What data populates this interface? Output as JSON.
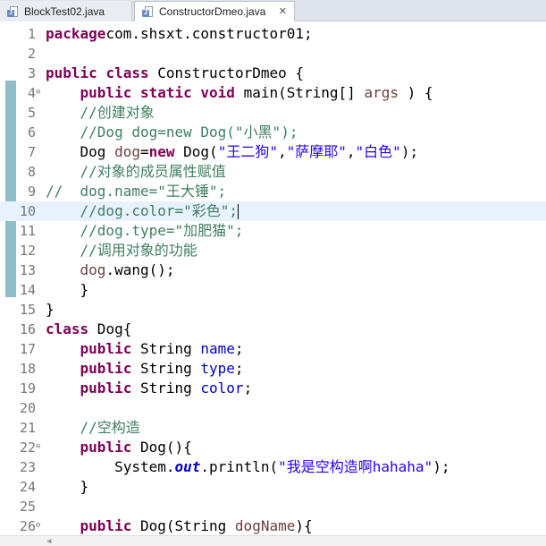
{
  "tabs": [
    {
      "label": "BlockTest02.java",
      "active": false
    },
    {
      "label": "ConstructorDmeo.java",
      "active": true,
      "close": "✕"
    }
  ],
  "colors": {
    "keyword": "#7f0055",
    "comment": "#3f7f5f",
    "string": "#2a00ff",
    "field": "#0000c0",
    "current_line": "#e8f2fe"
  },
  "editor": {
    "current_line": 10,
    "lines": [
      {
        "n": "1",
        "t": [
          [
            "kw",
            "package"
          ],
          [
            "",
            "com.shsxt.constructor01;"
          ]
        ]
      },
      {
        "n": "2",
        "t": []
      },
      {
        "n": "3",
        "t": [
          [
            "kw",
            "public"
          ],
          [
            "",
            " "
          ],
          [
            "kw",
            "class"
          ],
          [
            "",
            " ConstructorDmeo {"
          ]
        ]
      },
      {
        "n": "4",
        "fold": true,
        "t": [
          [
            "",
            "    "
          ],
          [
            "kw",
            "public"
          ],
          [
            "",
            " "
          ],
          [
            "kw",
            "static"
          ],
          [
            "",
            " "
          ],
          [
            "kw",
            "void"
          ],
          [
            "",
            " main(String[] "
          ],
          [
            "pm",
            "args"
          ],
          [
            "",
            " ) {"
          ]
        ]
      },
      {
        "n": "5",
        "t": [
          [
            "",
            "    "
          ],
          [
            "cm",
            "//创建对象"
          ]
        ]
      },
      {
        "n": "6",
        "t": [
          [
            "",
            "    "
          ],
          [
            "cm",
            "//Dog dog=new Dog(\"小黑\");"
          ]
        ]
      },
      {
        "n": "7",
        "t": [
          [
            "",
            "    Dog "
          ],
          [
            "vr",
            "dog"
          ],
          [
            "",
            "="
          ],
          [
            "kw",
            "new"
          ],
          [
            "",
            " Dog("
          ],
          [
            "st",
            "\"王二狗\""
          ],
          [
            "",
            ","
          ],
          [
            "st",
            "\"萨摩耶\""
          ],
          [
            "",
            ","
          ],
          [
            "st",
            "\"白色\""
          ],
          [
            "",
            ");"
          ]
        ]
      },
      {
        "n": "8",
        "t": [
          [
            "",
            "    "
          ],
          [
            "cm",
            "//对象的成员属性赋值"
          ]
        ]
      },
      {
        "n": "9",
        "t": [
          [
            "cm",
            "//  dog.name=\"王大锤\";"
          ]
        ]
      },
      {
        "n": "10",
        "t": [
          [
            "",
            "    "
          ],
          [
            "cm",
            "//dog.color=\"彩色\";"
          ]
        ],
        "cursor": true
      },
      {
        "n": "11",
        "t": [
          [
            "",
            "    "
          ],
          [
            "cm",
            "//dog.type=\"加肥猫\";"
          ]
        ]
      },
      {
        "n": "12",
        "t": [
          [
            "",
            "    "
          ],
          [
            "cm",
            "//调用对象的功能"
          ]
        ]
      },
      {
        "n": "13",
        "t": [
          [
            "",
            "    "
          ],
          [
            "vr",
            "dog"
          ],
          [
            "",
            ".wang();"
          ]
        ]
      },
      {
        "n": "14",
        "t": [
          [
            "",
            "    }"
          ]
        ]
      },
      {
        "n": "15",
        "t": [
          [
            "",
            "}"
          ]
        ]
      },
      {
        "n": "16",
        "t": [
          [
            "kw",
            "class"
          ],
          [
            "",
            " Dog{"
          ]
        ]
      },
      {
        "n": "17",
        "t": [
          [
            "",
            "    "
          ],
          [
            "kw",
            "public"
          ],
          [
            "",
            " String "
          ],
          [
            "fd",
            "name"
          ],
          [
            "",
            ";"
          ]
        ]
      },
      {
        "n": "18",
        "t": [
          [
            "",
            "    "
          ],
          [
            "kw",
            "public"
          ],
          [
            "",
            " String "
          ],
          [
            "fd",
            "type"
          ],
          [
            "",
            ";"
          ]
        ]
      },
      {
        "n": "19",
        "t": [
          [
            "",
            "    "
          ],
          [
            "kw",
            "public"
          ],
          [
            "",
            " String "
          ],
          [
            "fd",
            "color"
          ],
          [
            "",
            ";"
          ]
        ]
      },
      {
        "n": "20",
        "t": []
      },
      {
        "n": "21",
        "t": [
          [
            "",
            "    "
          ],
          [
            "cm",
            "//空构造"
          ]
        ]
      },
      {
        "n": "22",
        "fold": true,
        "t": [
          [
            "",
            "    "
          ],
          [
            "kw",
            "public"
          ],
          [
            "",
            " Dog(){"
          ]
        ]
      },
      {
        "n": "23",
        "t": [
          [
            "",
            "        System."
          ],
          [
            "sf",
            "out"
          ],
          [
            "",
            ".println("
          ],
          [
            "st",
            "\"我是空构造啊hahaha\""
          ],
          [
            "",
            ");"
          ]
        ]
      },
      {
        "n": "24",
        "t": [
          [
            "",
            "    }"
          ]
        ]
      },
      {
        "n": "25",
        "t": []
      },
      {
        "n": "26",
        "fold": true,
        "t": [
          [
            "",
            "    "
          ],
          [
            "kw",
            "public"
          ],
          [
            "",
            " Dog(String "
          ],
          [
            "pm",
            "dogName"
          ],
          [
            "",
            "){"
          ]
        ]
      }
    ]
  }
}
